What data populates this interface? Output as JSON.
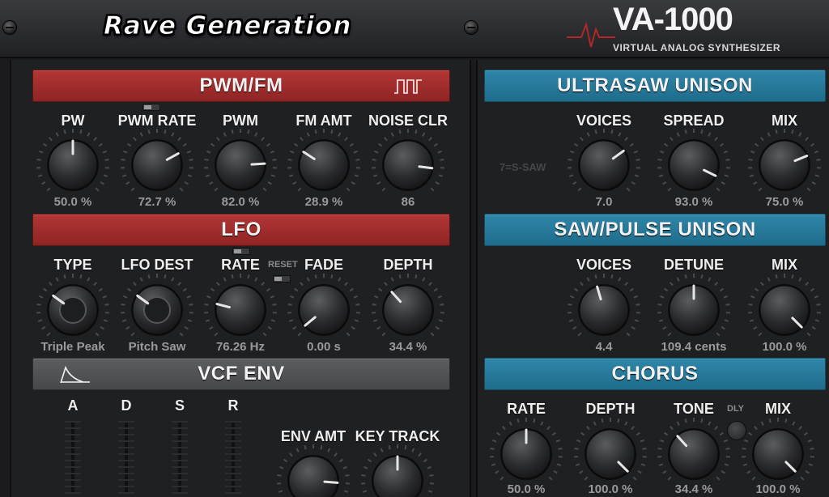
{
  "header": {
    "brand_left": "Rave Generation",
    "brand_right": "VA-1000",
    "brand_sub": "VIRTUAL ANALOG SYNTHESIZER"
  },
  "sections": {
    "pwm_fm": "PWM/FM",
    "lfo": "LFO",
    "vcf_env": "VCF ENV",
    "ultrasaw": "ULTRASAW UNISON",
    "saw_pulse": "SAW/PULSE UNISON",
    "chorus": "CHORUS"
  },
  "pwm_fm": {
    "knobs": [
      {
        "label": "PW",
        "value": "50.0 %",
        "level": 0.5
      },
      {
        "label": "PWM RATE",
        "value": "72.7 %",
        "level": 0.727
      },
      {
        "label": "PWM",
        "value": "82.0 %",
        "level": 0.82
      },
      {
        "label": "FM AMT",
        "value": "28.9 %",
        "level": 0.289
      },
      {
        "label": "NOISE CLR",
        "value": "86",
        "level": 0.86
      }
    ]
  },
  "lfo": {
    "reset_label": "RESET",
    "knobs": [
      {
        "label": "TYPE",
        "value": "Triple Peak",
        "level": 0.3,
        "style": "selector"
      },
      {
        "label": "LFO DEST",
        "value": "Pitch Saw",
        "level": 0.3,
        "style": "selector"
      },
      {
        "label": "RATE",
        "value": "76.26 Hz",
        "level": 0.22
      },
      {
        "label": "FADE",
        "value": "0.00 s",
        "level": 0.02
      },
      {
        "label": "DEPTH",
        "value": "34.4 %",
        "level": 0.344
      }
    ]
  },
  "vcf_env": {
    "sliders": [
      "A",
      "D",
      "S",
      "R"
    ],
    "knobs": [
      {
        "label": "ENV AMT",
        "value": "",
        "level": 0.85
      },
      {
        "label": "KEY TRACK",
        "value": "",
        "level": 0.5
      }
    ]
  },
  "ultrasaw": {
    "ghost_label": "7=S-SAW",
    "knobs": [
      {
        "label": "VOICES",
        "value": "7.0",
        "level": 0.7
      },
      {
        "label": "SPREAD",
        "value": "93.0 %",
        "level": 0.93
      },
      {
        "label": "MIX",
        "value": "75.0 %",
        "level": 0.75
      }
    ]
  },
  "saw_pulse": {
    "knobs": [
      {
        "label": "VOICES",
        "value": "4.4",
        "level": 0.44
      },
      {
        "label": "DETUNE",
        "value": "109.4 cents",
        "level": 0.5
      },
      {
        "label": "MIX",
        "value": "100.0 %",
        "level": 1.0
      }
    ]
  },
  "chorus": {
    "dly_label": "DLY",
    "knobs": [
      {
        "label": "RATE",
        "value": "50.0 %",
        "level": 0.5
      },
      {
        "label": "DEPTH",
        "value": "100.0 %",
        "level": 1.0
      },
      {
        "label": "TONE",
        "value": "34.4 %",
        "level": 0.344
      },
      {
        "label": "MIX",
        "value": "100.0 %",
        "level": 1.0
      }
    ]
  }
}
